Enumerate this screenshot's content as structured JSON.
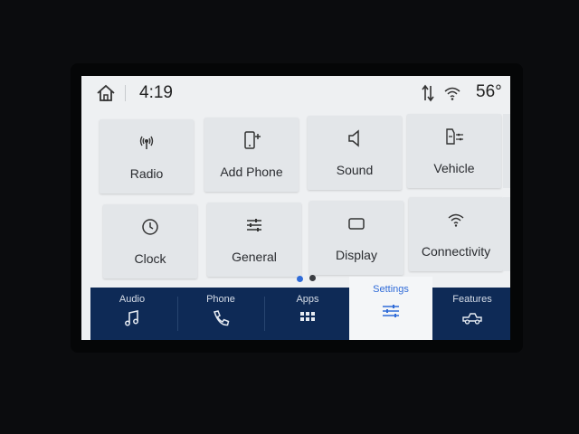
{
  "status": {
    "time": "4:19",
    "temperature": "56°"
  },
  "tiles": [
    {
      "label": "Radio",
      "icon": "radio-antenna-icon"
    },
    {
      "label": "Add Phone",
      "icon": "add-phone-icon"
    },
    {
      "label": "Sound",
      "icon": "speaker-icon"
    },
    {
      "label": "Vehicle",
      "icon": "vehicle-settings-icon"
    },
    {
      "label": "Clock",
      "icon": "clock-icon"
    },
    {
      "label": "General",
      "icon": "sliders-icon"
    },
    {
      "label": "Display",
      "icon": "display-icon"
    },
    {
      "label": "Connectivity",
      "icon": "wifi-icon"
    }
  ],
  "nav": {
    "items": [
      {
        "label": "Audio",
        "icon": "music-note-icon"
      },
      {
        "label": "Phone",
        "icon": "phone-icon"
      },
      {
        "label": "Apps",
        "icon": "apps-grid-icon"
      },
      {
        "label": "Settings",
        "icon": "settings-sliders-icon"
      },
      {
        "label": "Features",
        "icon": "truck-icon"
      }
    ],
    "active": "Settings"
  },
  "colors": {
    "nav_bg": "#0e2a56",
    "accent": "#2f6bd8",
    "tile_bg": "#e3e6e9"
  }
}
